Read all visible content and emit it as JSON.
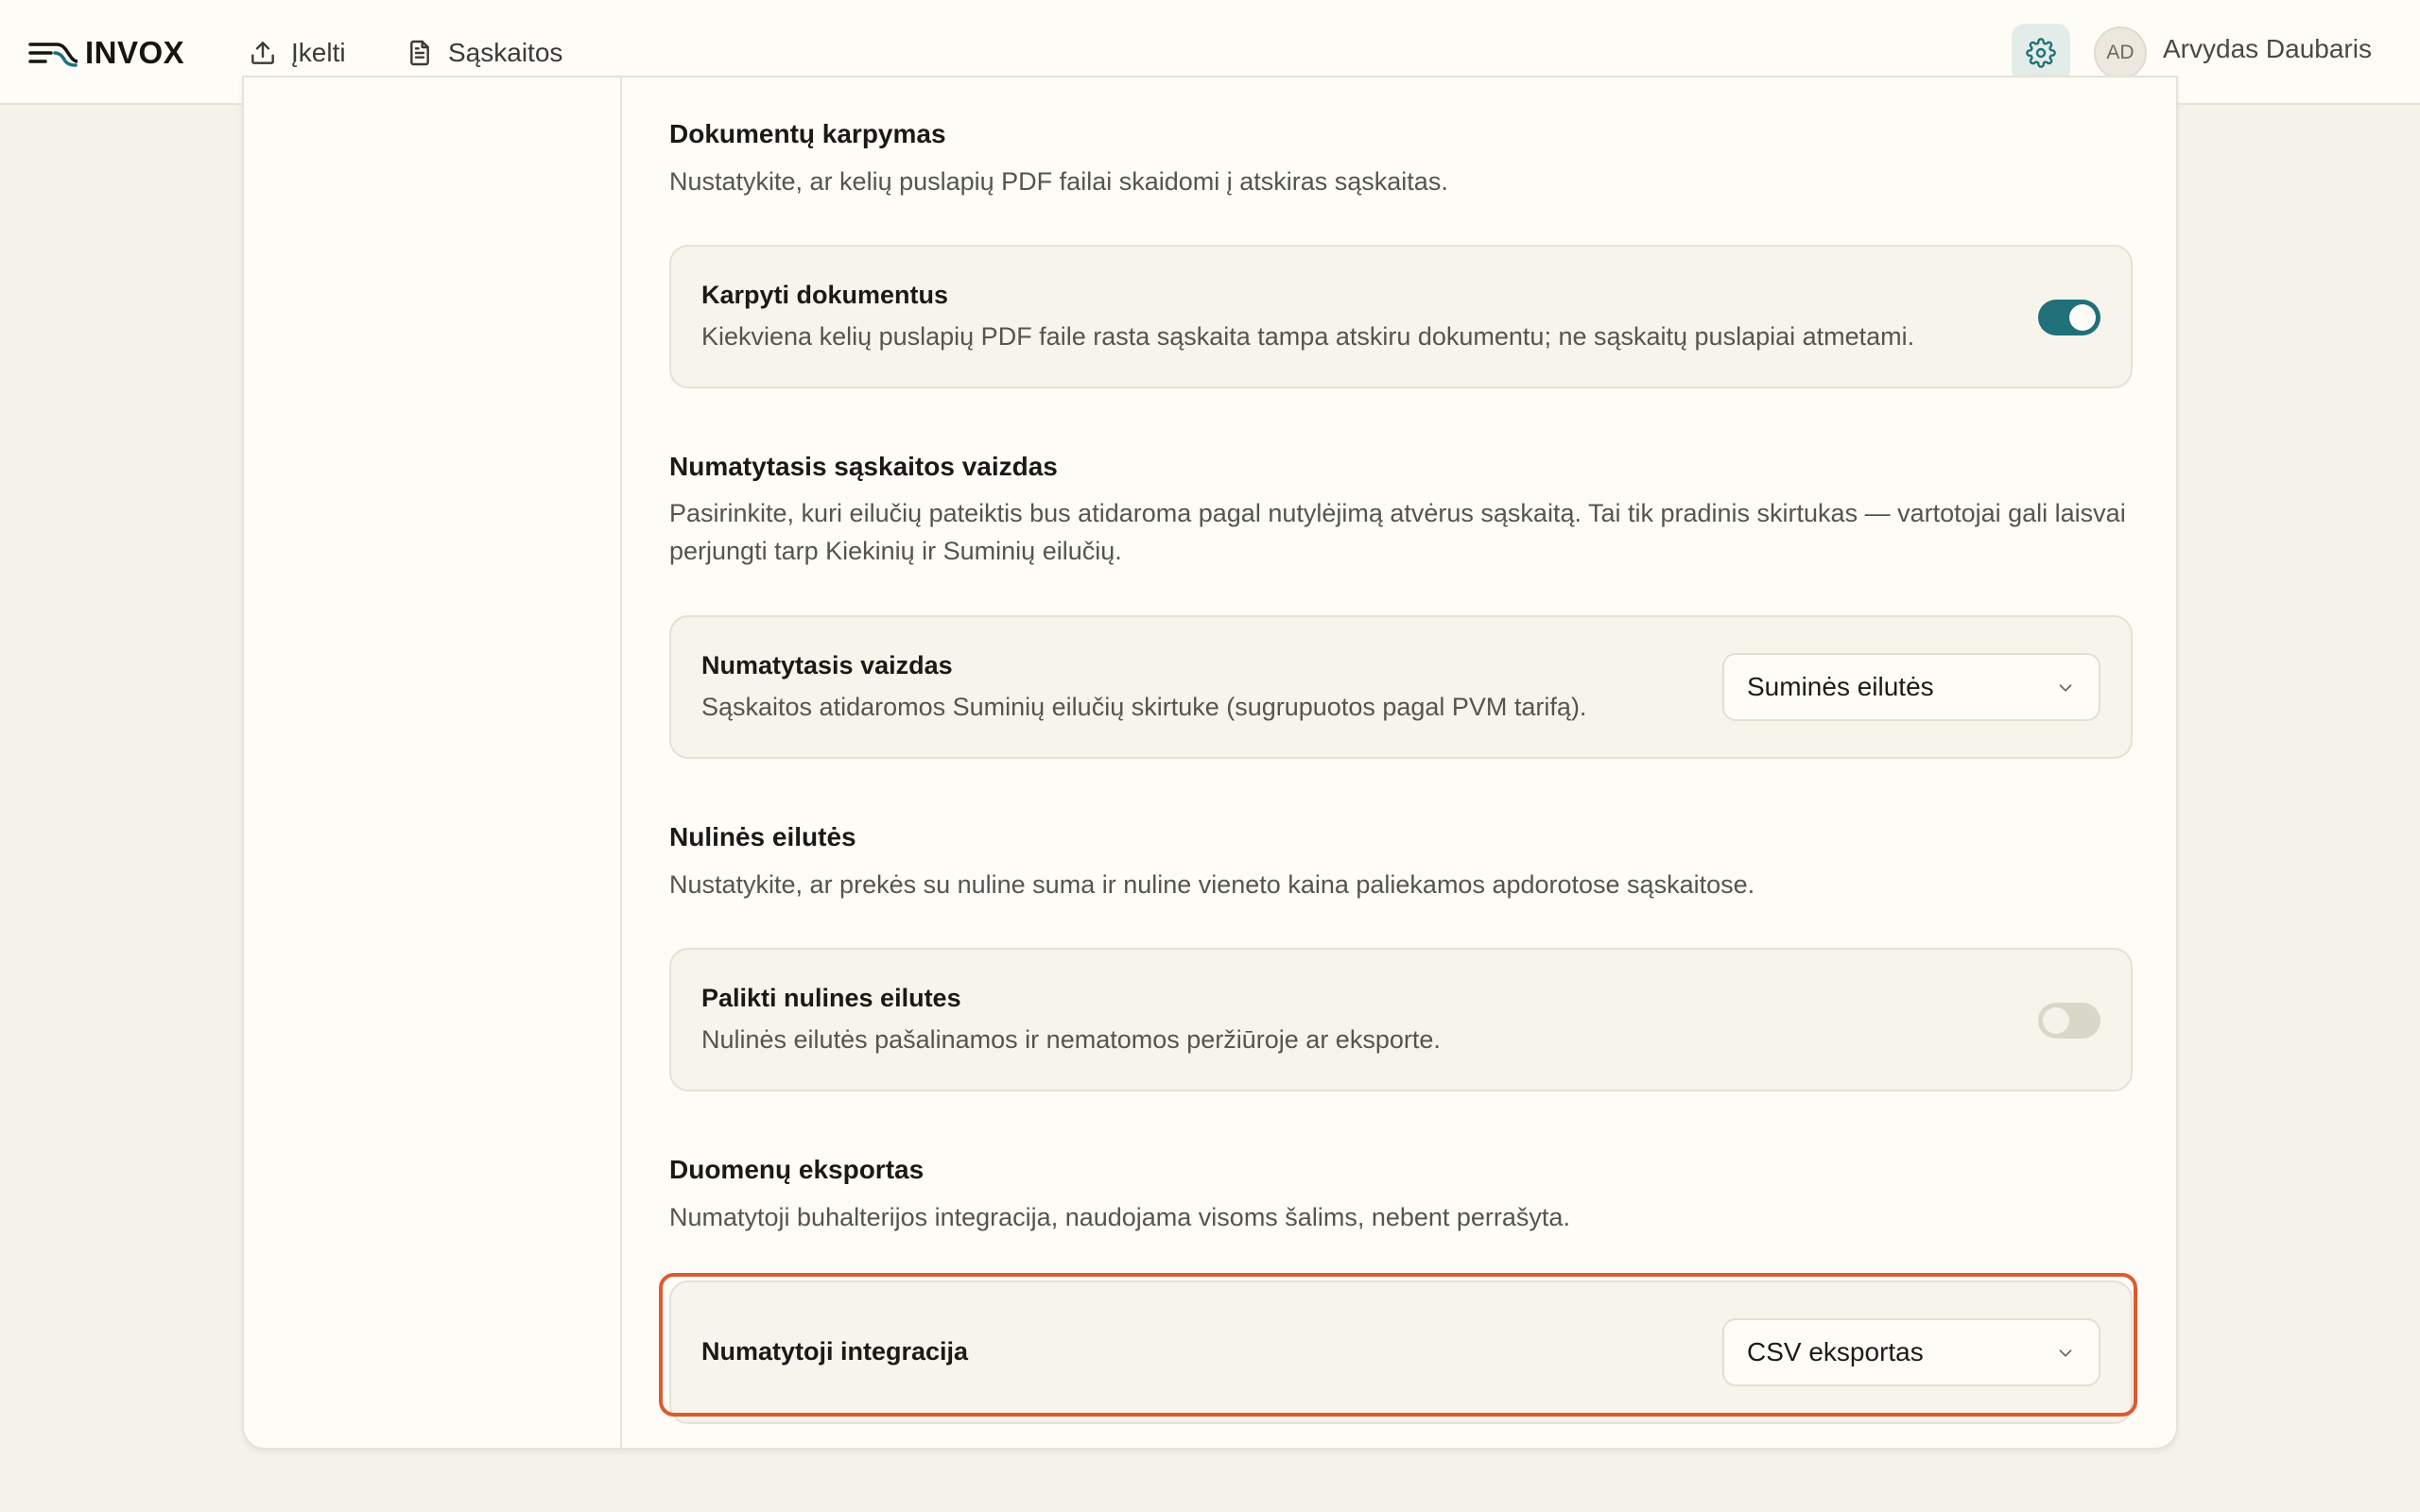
{
  "app": {
    "logo_text": "INVOX"
  },
  "nav": {
    "upload_label": "Įkelti",
    "invoices_label": "Sąskaitos"
  },
  "user": {
    "initials": "AD",
    "name": "Arvydas Daubaris"
  },
  "sections": {
    "splitting": {
      "title": "Dokumentų karpymas",
      "desc": "Nustatykite, ar kelių puslapių PDF failai skaidomi į atskiras sąskaitas.",
      "setting_label": "Karpyti dokumentus",
      "setting_help": "Kiekviena kelių puslapių PDF faile rasta sąskaita tampa atskiru dokumentu; ne sąskaitų puslapiai atmetami.",
      "toggle_on": true
    },
    "default_view": {
      "title": "Numatytasis sąskaitos vaizdas",
      "desc": "Pasirinkite, kuri eilučių pateiktis bus atidaroma pagal nutylėjimą atvėrus sąskaitą. Tai tik pradinis skirtukas — vartotojai gali laisvai perjungti tarp Kiekinių ir Suminių eilučių.",
      "setting_label": "Numatytasis vaizdas",
      "setting_help": "Sąskaitos atidaromos Suminių eilučių skirtuke (sugrupuotos pagal PVM tarifą).",
      "selected": "Suminės eilutės"
    },
    "zero_rows": {
      "title": "Nulinės eilutės",
      "desc": "Nustatykite, ar prekės su nuline suma ir nuline vieneto kaina paliekamos apdorotose sąskaitose.",
      "setting_label": "Palikti nulines eilutes",
      "setting_help": "Nulinės eilutės pašalinamos ir nematomos peržiūroje ar eksporte.",
      "toggle_on": false
    },
    "export": {
      "title": "Duomenų eksportas",
      "desc": "Numatytoji buhalterijos integracija, naudojama visoms šalims, nebent perrašyta.",
      "setting_label": "Numatytoji integracija",
      "selected": "CSV eksportas"
    }
  },
  "colors": {
    "accent": "#1f7078",
    "highlight": "#dd5a2e",
    "background": "#f5f2ea",
    "card": "#fdfcf7"
  }
}
